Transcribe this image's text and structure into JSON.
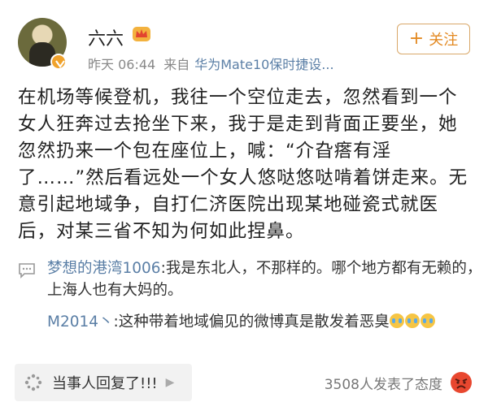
{
  "post": {
    "author": "六六",
    "time": "昨天 06:44",
    "source_prefix": "来自",
    "source": "华为Mate10保时捷设...",
    "follow_label": "关注",
    "text": "在机场等候登机，我往一个空位走去，忽然看到一个女人狂奔过去抢坐下来，我于是走到背面正要坐，她忽然扔来一个包在座位上，喊：“介旮瘩有淫了……”然后看远处一个女人悠哒悠哒啃着饼走来。无意引起地域争，自打仁济医院出现某地碰瓷式就医后，对某三省不知为何如此捏鼻。"
  },
  "comments": [
    {
      "user": "梦想的港湾1006",
      "text": ":我是东北人，不那样的。哪个地方都有无赖的，上海人也有大妈的。"
    },
    {
      "user": "M2014丶",
      "text": ":这种带着地域偏见的微博真是散发着恶臭"
    }
  ],
  "footer": {
    "reply_label": "当事人回复了!!!",
    "reactions": "3508人发表了态度"
  },
  "colors": {
    "link": "#5b7fa6",
    "follow": "#e38a23",
    "badge": "#f0a22b"
  },
  "icons": [
    "avatar",
    "verified-badge-icon",
    "crown-member-icon",
    "comment-icon",
    "tear-laugh-emoji-icon",
    "sparkle-icon",
    "chevron-right-icon",
    "angry-emoji-icon"
  ]
}
